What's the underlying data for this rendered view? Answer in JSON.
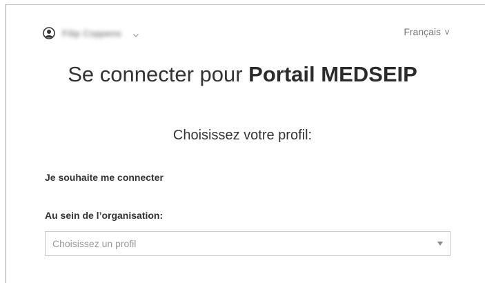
{
  "header": {
    "user_name": "Filip Coppens",
    "language": "Français",
    "language_chevron": "v"
  },
  "main": {
    "title_prefix": "Se connecter pour ",
    "title_brand": "Portail MEDSEIP",
    "subtitle": "Choisissez votre profil:",
    "connect_label": "Je souhaite me connecter",
    "org_label": "Au sein de l’organisation:",
    "profile_select": {
      "placeholder": "Choisissez un profil"
    }
  },
  "icons": {
    "avatar": "user-circle-icon",
    "user_menu": "chevron-down-icon",
    "select": "caret-down-icon"
  }
}
